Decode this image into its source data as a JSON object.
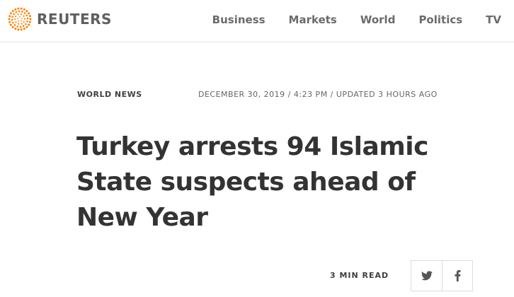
{
  "header": {
    "logo_text": "REUTERS",
    "logo_icon": "reuters-dot-circle-icon",
    "nav": [
      {
        "label": "Business"
      },
      {
        "label": "Markets"
      },
      {
        "label": "World"
      },
      {
        "label": "Politics"
      },
      {
        "label": "TV"
      }
    ]
  },
  "article": {
    "section": "WORLD NEWS",
    "date": "DECEMBER 30, 2019 / 4:23 PM / UPDATED 3 HOURS AGO",
    "headline": "Turkey arrests 94 Islamic State suspects ahead of New Year",
    "read_time": "3 MIN READ"
  },
  "share": [
    {
      "icon": "twitter-icon"
    },
    {
      "icon": "facebook-icon"
    }
  ],
  "colors": {
    "brand_orange": "#ff8000",
    "text_dark": "#333333",
    "nav_gray": "#6b6b6b"
  }
}
